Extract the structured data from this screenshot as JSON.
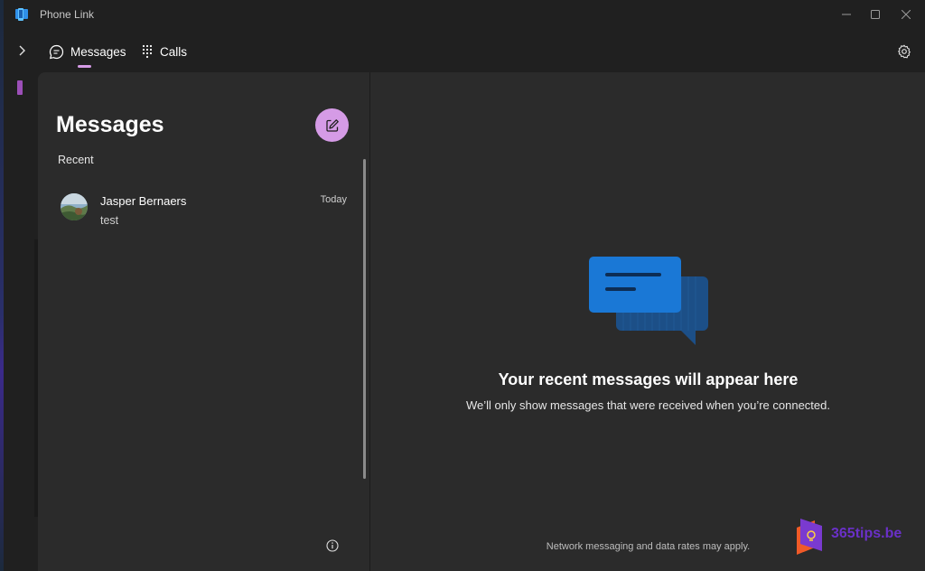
{
  "window": {
    "title": "Phone Link"
  },
  "nav": {
    "tabs": [
      {
        "label": "Messages",
        "icon": "chat-bubble-icon",
        "selected": true
      },
      {
        "label": "Calls",
        "icon": "dialpad-icon",
        "selected": false
      }
    ]
  },
  "messages_panel": {
    "title": "Messages",
    "section_label": "Recent",
    "conversations": [
      {
        "name": "Jasper Bernaers",
        "preview": "test",
        "time": "Today"
      }
    ]
  },
  "detail": {
    "empty_title": "Your recent messages will appear here",
    "empty_subtitle": "We’ll only show messages that were received when you’re connected.",
    "footer_note": "Network messaging and data rates may apply."
  },
  "watermark": {
    "text": "365tips.be"
  },
  "colors": {
    "accent": "#d59be6",
    "bubble_front": "#1a78d6",
    "bubble_back": "#1c4f87",
    "background": "#2b2b2b"
  }
}
